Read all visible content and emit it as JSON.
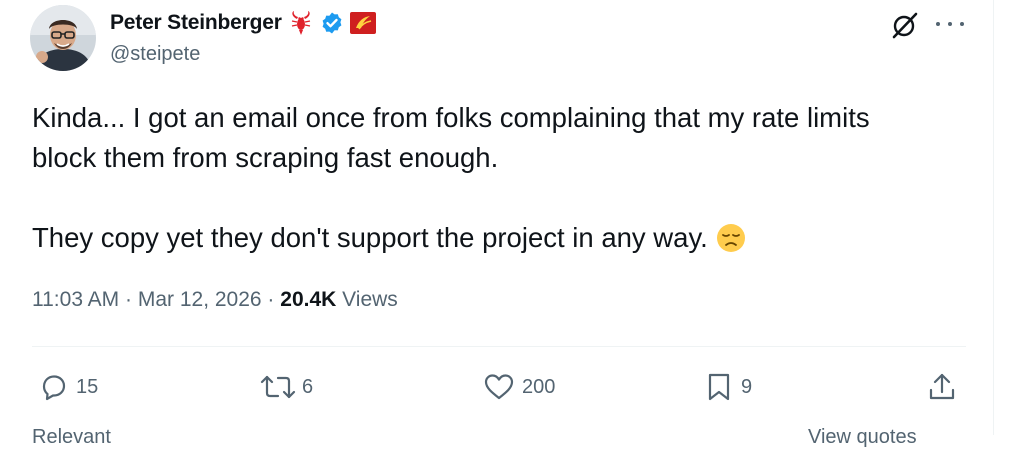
{
  "author": {
    "display_name": "Peter Steinberger",
    "handle": "@steipete",
    "badges": [
      "lobster-icon",
      "verified-badge-icon",
      "affiliate-flag-icon"
    ],
    "colors": {
      "verified": "#1d9bf0",
      "lobster": "#e0222c",
      "flag": "#cf1f1f"
    }
  },
  "tweet": {
    "lines": [
      "Kinda... I got an email once from folks complaining that my rate limits",
      "block them from scraping fast enough.",
      "They copy yet they don't support the project in any way."
    ],
    "emoji": "disappointed-face-icon"
  },
  "meta": {
    "time": "11:03 AM",
    "sep1": " · ",
    "date": "Mar 12, 2026",
    "sep2": " · ",
    "views_count": "20.4K",
    "views_label": " Views"
  },
  "actions": {
    "replies": "15",
    "reposts": "6",
    "likes": "200",
    "bookmarks": "9"
  },
  "footer": {
    "left_cut": "Relevant",
    "right_cut": "View quotes"
  },
  "colors": {
    "text": "#0f1419",
    "secondary": "#536471",
    "divider": "#eff3f4"
  }
}
